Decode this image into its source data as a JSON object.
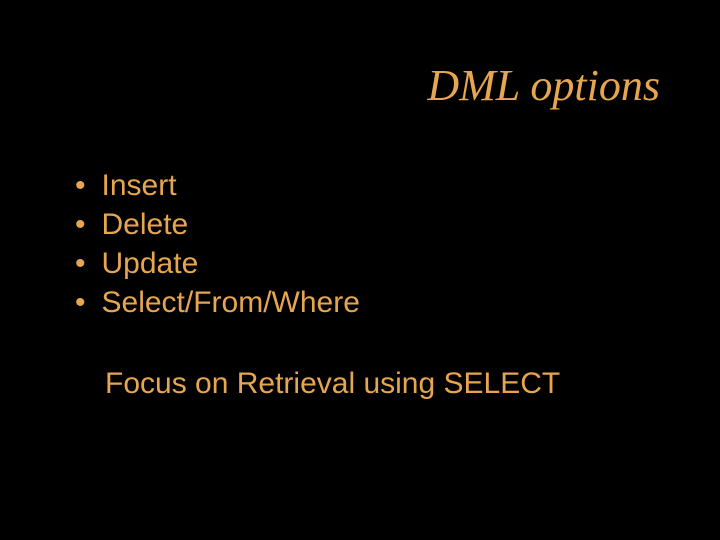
{
  "title": "DML options",
  "bullets": {
    "dot": "•",
    "items": [
      "Insert",
      "Delete",
      "Update",
      "Select/From/Where"
    ]
  },
  "footer": "Focus on Retrieval using SELECT"
}
